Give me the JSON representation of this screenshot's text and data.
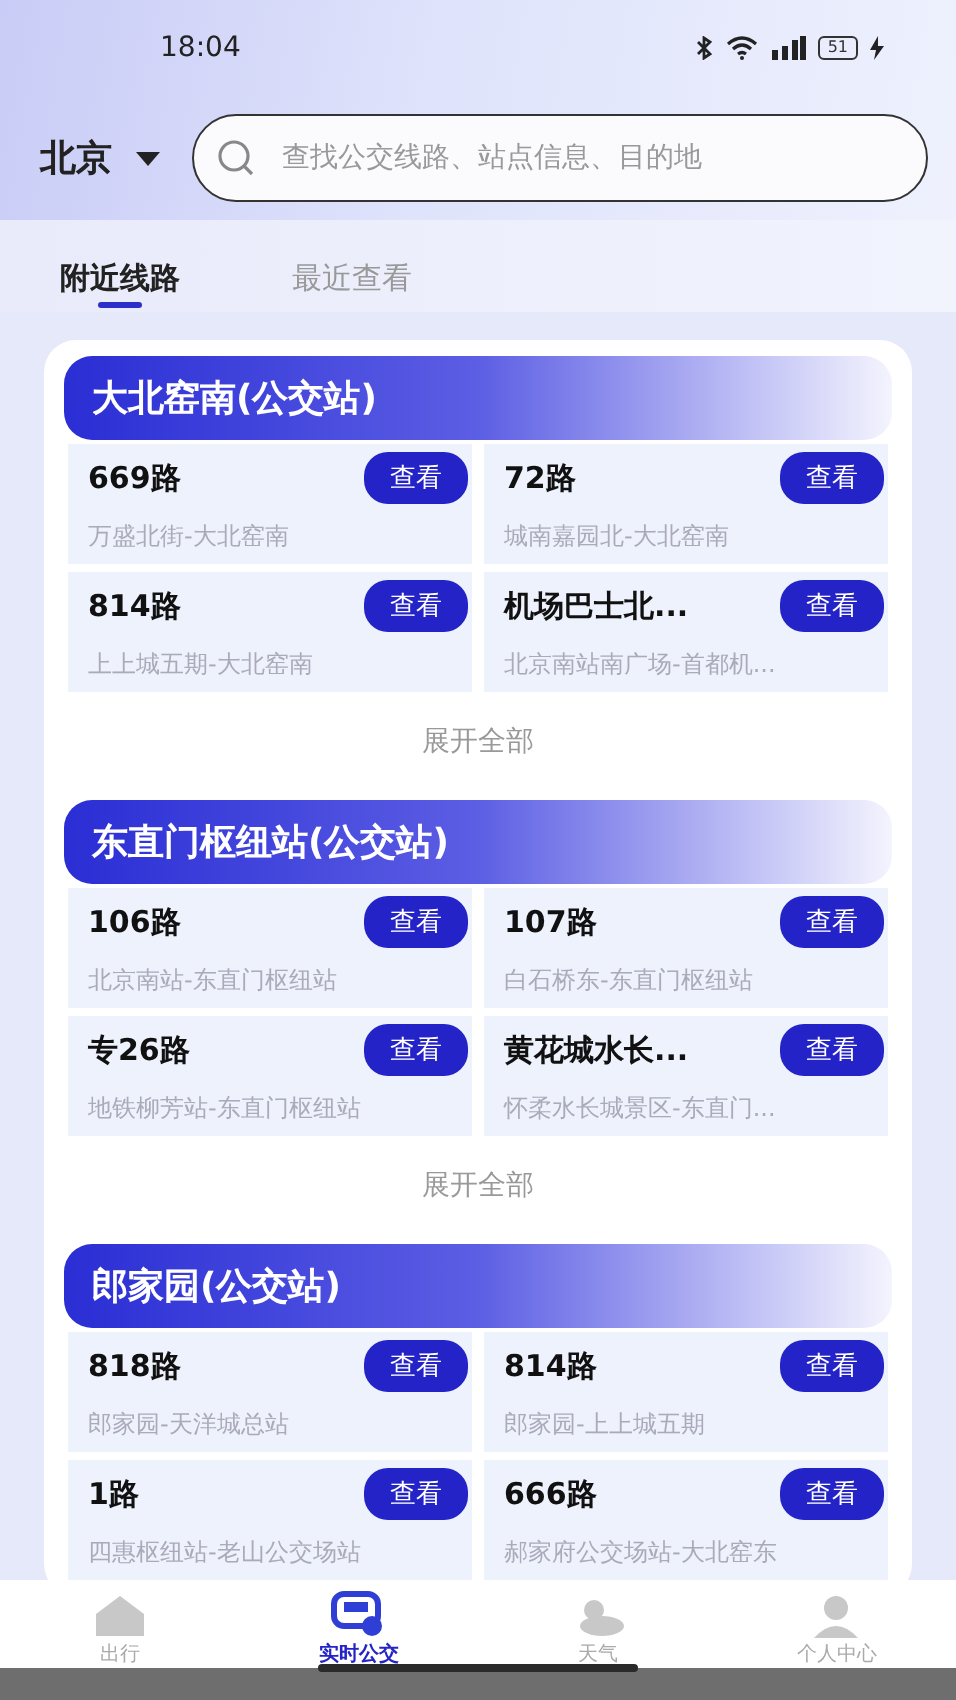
{
  "status_bar": {
    "time": "18:04",
    "battery": "51"
  },
  "header": {
    "city": "北京",
    "search": {
      "placeholder": "查找公交线路、站点信息、目的地"
    }
  },
  "tabs": [
    {
      "label": "附近线路",
      "selected": true
    },
    {
      "label": "最近查看",
      "selected": false
    }
  ],
  "stations": [
    {
      "name": "大北窑南(公交站)",
      "expand": "展开全部",
      "routes": [
        {
          "name": "669路",
          "path": "万盛北街-大北窑南",
          "button": "查看"
        },
        {
          "name": "72路",
          "path": "城南嘉园北-大北窑南",
          "button": "查看"
        },
        {
          "name": "814路",
          "path": "上上城五期-大北窑南",
          "button": "查看"
        },
        {
          "name": "机场巴士北...",
          "path": "北京南站南广场-首都机...",
          "button": "查看"
        }
      ]
    },
    {
      "name": "东直门枢纽站(公交站)",
      "expand": "展开全部",
      "routes": [
        {
          "name": "106路",
          "path": "北京南站-东直门枢纽站",
          "button": "查看"
        },
        {
          "name": "107路",
          "path": "白石桥东-东直门枢纽站",
          "button": "查看"
        },
        {
          "name": "专26路",
          "path": "地铁柳芳站-东直门枢纽站",
          "button": "查看"
        },
        {
          "name": "黄花城水长...",
          "path": "怀柔水长城景区-东直门...",
          "button": "查看"
        }
      ]
    },
    {
      "name": "郎家园(公交站)",
      "routes": [
        {
          "name": "818路",
          "path": "郎家园-天洋城总站",
          "button": "查看"
        },
        {
          "name": "814路",
          "path": "郎家园-上上城五期",
          "button": "查看"
        },
        {
          "name": "1路",
          "path": "四惠枢纽站-老山公交场站",
          "button": "查看"
        },
        {
          "name": "666路",
          "path": "郝家府公交场站-大北窑东",
          "button": "查看"
        }
      ]
    }
  ],
  "bottom_nav": [
    {
      "label": "出行",
      "kind": "home",
      "selected": false
    },
    {
      "label": "实时公交",
      "kind": "bus",
      "selected": true
    },
    {
      "label": "天气",
      "kind": "weather",
      "selected": false
    },
    {
      "label": "个人中心",
      "kind": "user",
      "selected": false
    }
  ]
}
